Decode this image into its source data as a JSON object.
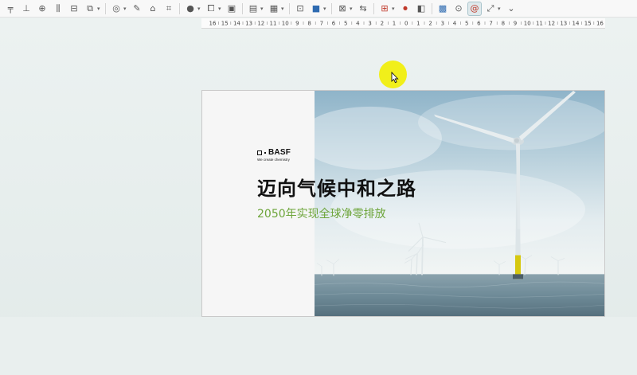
{
  "toolbar": {
    "items": [
      {
        "name": "align-left-icon",
        "glyph": "╤"
      },
      {
        "name": "align-bottom-icon",
        "glyph": "⊥"
      },
      {
        "name": "align-center-icon",
        "glyph": "⊕"
      },
      {
        "name": "distribute-icon",
        "glyph": "⫼"
      },
      {
        "name": "align-middle-icon",
        "glyph": "⊟"
      },
      {
        "name": "arrange-icon",
        "glyph": "⧉"
      },
      {
        "name": "shapes-icon",
        "glyph": "◎"
      },
      {
        "name": "pen-icon",
        "glyph": "✎"
      },
      {
        "name": "eraser-icon",
        "glyph": "⌂"
      },
      {
        "name": "crop-icon",
        "glyph": "⌗"
      },
      {
        "name": "shadow-icon",
        "glyph": "●"
      },
      {
        "name": "group-icon",
        "glyph": "⧠"
      },
      {
        "name": "image-icon",
        "glyph": "▣"
      },
      {
        "name": "chart-icon",
        "glyph": "▤"
      },
      {
        "name": "table-icon",
        "glyph": "▦"
      },
      {
        "name": "text-icon",
        "glyph": "⊡"
      },
      {
        "name": "fill-color-icon",
        "glyph": "■"
      },
      {
        "name": "frame-icon",
        "glyph": "⊠"
      },
      {
        "name": "arrow-icon",
        "glyph": "⇆"
      },
      {
        "name": "insert-icon",
        "glyph": "⊞"
      },
      {
        "name": "record-icon",
        "glyph": "⏺"
      },
      {
        "name": "media-icon",
        "glyph": "◧"
      },
      {
        "name": "gallery-icon",
        "glyph": "▩"
      },
      {
        "name": "comment-icon",
        "glyph": "⊙"
      },
      {
        "name": "link-icon",
        "glyph": "@"
      },
      {
        "name": "more-icon",
        "glyph": "⤢"
      },
      {
        "name": "overflow-icon",
        "glyph": "⌄"
      }
    ]
  },
  "ruler": {
    "labels": [
      "16",
      "15",
      "14",
      "13",
      "12",
      "11",
      "10",
      "9",
      "8",
      "7",
      "6",
      "5",
      "4",
      "3",
      "2",
      "1",
      "0",
      "1",
      "2",
      "3",
      "4",
      "5",
      "6",
      "7",
      "8",
      "9",
      "10",
      "11",
      "12",
      "13",
      "14",
      "15",
      "16"
    ]
  },
  "slide": {
    "logo_word": "BASF",
    "logo_tagline": "We create chemistry",
    "title": "迈向气候中和之路",
    "subtitle": "2050年实现全球净零排放"
  },
  "colors": {
    "accent_green": "#6da53a",
    "cursor_highlight": "#f1ef1a"
  }
}
